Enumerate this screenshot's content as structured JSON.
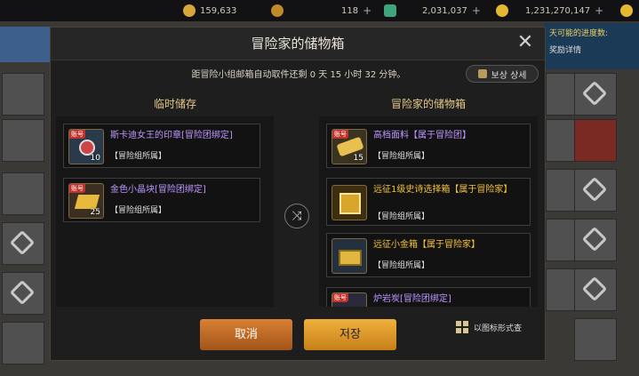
{
  "topbar": {
    "resources": [
      {
        "icon": "gold-pouch-icon",
        "value": "159,633",
        "color": "#d9a63a"
      },
      {
        "icon": "cera-coin-icon",
        "value": "118",
        "color": "#c08a2b"
      },
      {
        "icon": "green-gem-icon",
        "value": "2,031,037",
        "color": "#3fa67c"
      },
      {
        "icon": "gold-coin-icon",
        "value": "1,231,270,147",
        "color": "#e6b832"
      }
    ],
    "plus": "+"
  },
  "side_panel": {
    "line1": "天可能的进度数:",
    "line2": "奖励详情"
  },
  "modal": {
    "title": "冒险家的储物箱",
    "close": "✕",
    "notice": "距冒险小组邮箱自动取件还剩 0 天 15 小时 32 分钟。",
    "reward_button": "보상 상세",
    "temp_storage": {
      "heading": "临时储存",
      "items": [
        {
          "name": "斯卡迪女王的印章[冒险团绑定]",
          "sub": "【冒险组所属】",
          "qty": "10",
          "tag": "账号",
          "color": "#bd96ff",
          "icon": "seal-medal-icon",
          "bg": "#2b3a4a"
        },
        {
          "name": "金色小晶块[冒险团绑定]",
          "sub": "【冒险组所属】",
          "qty": "25",
          "tag": "账号",
          "color": "#bd96ff",
          "icon": "gold-crystal-icon",
          "bg": "#3a2f20"
        }
      ]
    },
    "adventurer_storage": {
      "heading": "冒险家的储物箱",
      "items": [
        {
          "name": "高档面料【属于冒险团】",
          "sub": "【冒险组所属】",
          "qty": "15",
          "tag": "账号",
          "color": "#bd96ff",
          "icon": "fabric-roll-icon",
          "bg": "#3a3320"
        },
        {
          "name": "远征1级史诗选择箱【属于冒险家】",
          "sub": "【冒险组所属】",
          "qty": "",
          "tag": "",
          "color": "#f5c23a",
          "icon": "epic-box-icon",
          "bg": "#3d2f10"
        },
        {
          "name": "远征小金箱【属于冒险家】",
          "sub": "【冒险组所属】",
          "qty": "",
          "tag": "",
          "color": "#f5c23a",
          "icon": "gold-chest-icon",
          "bg": "#233040"
        },
        {
          "name": "炉岩炭[冒险团绑定]",
          "sub": "",
          "qty": "",
          "tag": "账号",
          "color": "#bd96ff",
          "icon": "coal-icon",
          "bg": "#2a2a3a"
        }
      ]
    },
    "cancel": "取消",
    "save": "저장",
    "view_toggle": "以图标形式查"
  }
}
